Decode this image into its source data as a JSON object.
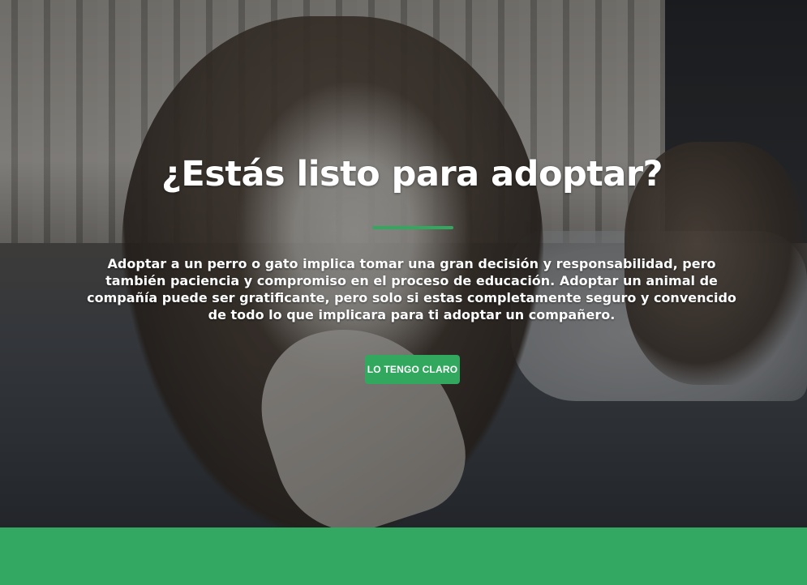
{
  "hero": {
    "title": "¿Estás listo para adoptar?",
    "description": "Adoptar a un perro o gato implica tomar una gran decisión y responsabilidad, pero también paciencia y compromiso en el proceso de educación. Adoptar un animal de compañía puede ser gratificante, pero solo si estas completamente seguro y convencido de todo lo que implicara para ti adoptar un compañero.",
    "button_label": "LO TENGO CLARO",
    "background_image": "cat-stretching-photo"
  },
  "colors": {
    "accent": "#32a85f",
    "overlay": "rgba(0,0,0,0.42)",
    "text": "#ffffff"
  }
}
